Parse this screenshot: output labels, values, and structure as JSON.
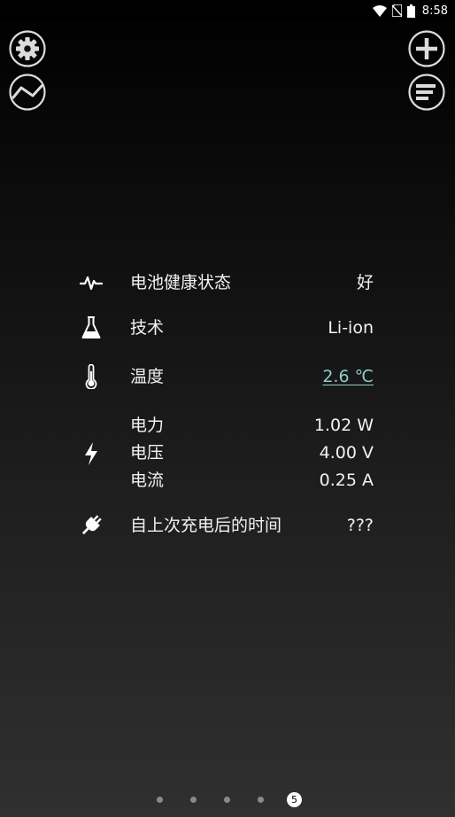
{
  "status_bar": {
    "time": "8:58",
    "icons": [
      "wifi-icon",
      "no-sim-icon",
      "battery-icon"
    ]
  },
  "toolbar": {
    "left": [
      "gear-icon",
      "graph-icon"
    ],
    "right": [
      "plus-icon",
      "list-icon"
    ]
  },
  "battery_info": {
    "health": {
      "icon": "pulse-icon",
      "label": "电池健康状态",
      "value": "好"
    },
    "technology": {
      "icon": "flask-icon",
      "label": "技术",
      "value": "Li-ion"
    },
    "temperature": {
      "icon": "thermometer-icon",
      "label": "温度",
      "value": "2.6 ℃",
      "color": "#8fcfc6"
    },
    "electric": {
      "icon": "lightning-icon",
      "power": {
        "label": "电力",
        "value": "1.02 W"
      },
      "voltage": {
        "label": "电压",
        "value": "4.00 V"
      },
      "current": {
        "label": "电流",
        "value": "0.25 A"
      }
    },
    "since_charge": {
      "icon": "plug-icon",
      "label": "自上次充电后的时间",
      "value": "???"
    }
  },
  "pager": {
    "pages": 5,
    "active_page": "5"
  },
  "colors": {
    "background_top": "#000000",
    "background_bottom": "#303030",
    "accent": "#8fcfc6"
  }
}
